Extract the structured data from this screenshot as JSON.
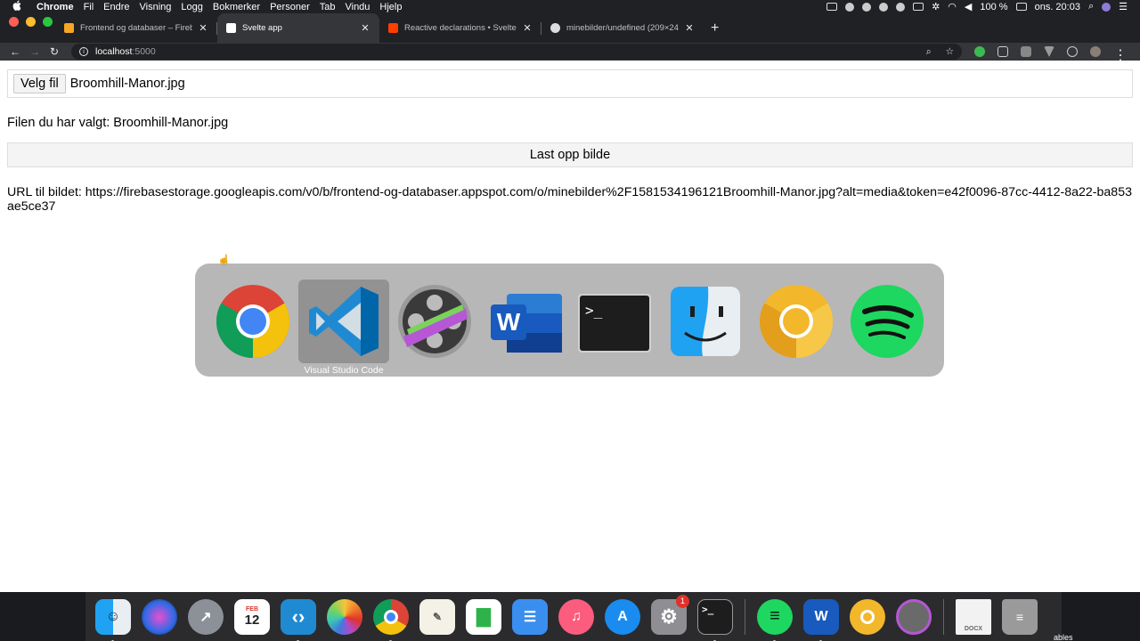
{
  "menubar": {
    "app_name": "Chrome",
    "menus": [
      "Fil",
      "Endre",
      "Visning",
      "Logg",
      "Bokmerker",
      "Personer",
      "Tab",
      "Vindu",
      "Hjelp"
    ],
    "battery": "100 %",
    "clock": "ons. 20:03"
  },
  "tabs": [
    {
      "title": "Frontend og databaser – Fireba",
      "favicon_color": "#f6a623"
    },
    {
      "title": "Svelte app",
      "favicon_color": "#ffffff"
    },
    {
      "title": "Reactive declarations • Svelte",
      "favicon_color": "#ff3e00"
    },
    {
      "title": "minebilder/undefined (209×24",
      "favicon_color": "#dadce0"
    }
  ],
  "toolbar": {
    "url_host": "localhost",
    "url_port": ":5000"
  },
  "page": {
    "file_button": "Velg fil",
    "file_name": "Broomhill-Manor.jpg",
    "chosen_text": "Filen du har valgt: Broomhill-Manor.jpg",
    "upload_button": "Last opp bilde",
    "url_text": "URL til bildet: https://firebasestorage.googleapis.com/v0/b/frontend-og-databaser.appspot.com/o/minebilder%2F1581534196121Broomhill-Manor.jpg?alt=media&token=e42f0096-87cc-4412-8a22-ba853ae5ce37"
  },
  "switcher": {
    "apps": [
      "chrome",
      "visual-studio-code",
      "final-cut",
      "word",
      "terminal",
      "finder",
      "chrome-canary",
      "spotify"
    ],
    "selected_label": "Visual Studio Code"
  },
  "dock": {
    "apps": [
      "finder",
      "siri",
      "launchpad",
      "calendar",
      "vscode",
      "photos",
      "chrome",
      "textedit",
      "numbers",
      "keynote",
      "music",
      "app-store",
      "system-preferences",
      "terminal",
      "spotify",
      "word",
      "chrome-canary",
      "final-cut"
    ],
    "calendar_month": "FEB",
    "calendar_day": "12",
    "system_prefs_badge": "1",
    "label_fragment": "ables"
  }
}
